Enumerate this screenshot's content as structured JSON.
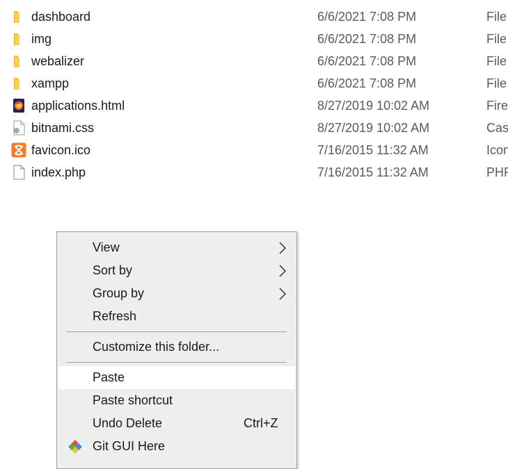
{
  "files": [
    {
      "name": "dashboard",
      "date": "6/6/2021 7:08 PM",
      "type": "File",
      "icon": "folder-icon"
    },
    {
      "name": "img",
      "date": "6/6/2021 7:08 PM",
      "type": "File",
      "icon": "folder-icon"
    },
    {
      "name": "webalizer",
      "date": "6/6/2021 7:08 PM",
      "type": "File",
      "icon": "folder-icon"
    },
    {
      "name": "xampp",
      "date": "6/6/2021 7:08 PM",
      "type": "File",
      "icon": "folder-icon"
    },
    {
      "name": "applications.html",
      "date": "8/27/2019 10:02 AM",
      "type": "Firef",
      "icon": "firefox-html-icon"
    },
    {
      "name": "bitnami.css",
      "date": "8/27/2019 10:02 AM",
      "type": "Casc",
      "icon": "css-file-icon"
    },
    {
      "name": "favicon.ico",
      "date": "7/16/2015 11:32 AM",
      "type": "Icon",
      "icon": "xampp-icon"
    },
    {
      "name": "index.php",
      "date": "7/16/2015 11:32 AM",
      "type": "PHP",
      "icon": "blank-file-icon"
    }
  ],
  "context_menu": {
    "items": [
      {
        "label": "View",
        "submenu": true
      },
      {
        "label": "Sort by",
        "submenu": true
      },
      {
        "label": "Group by",
        "submenu": true
      },
      {
        "label": "Refresh"
      },
      {
        "label": "Customize this folder..."
      },
      {
        "label": "Paste",
        "highlighted": true
      },
      {
        "label": "Paste shortcut"
      },
      {
        "label": "Undo Delete",
        "shortcut": "Ctrl+Z"
      },
      {
        "label": "Git GUI Here",
        "icon": "git-icon"
      }
    ]
  },
  "colors": {
    "folder": "#f8cf54",
    "menu_bg": "#eeeeee",
    "menu_highlight": "#ffffff",
    "separator": "#a0a0a0"
  }
}
